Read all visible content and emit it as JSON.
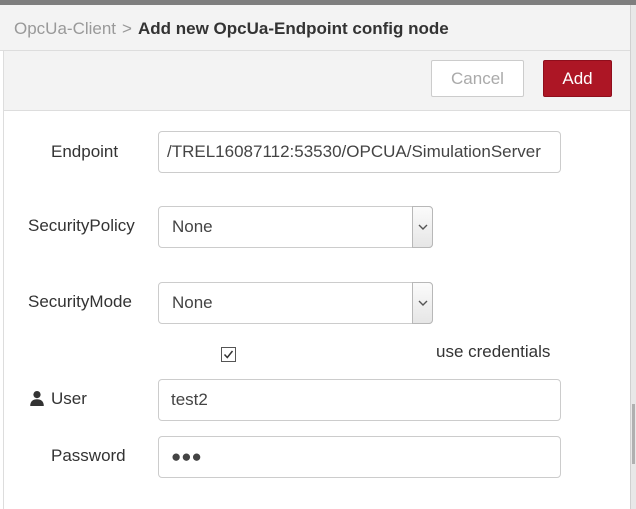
{
  "header": {
    "parent": "OpcUa-Client",
    "separator": ">",
    "title": "Add new OpcUa-Endpoint config node"
  },
  "toolbar": {
    "cancel_label": "Cancel",
    "add_label": "Add",
    "add_color": "#ad1625"
  },
  "form": {
    "endpoint": {
      "label": "Endpoint",
      "value": "/TREL16087112:53530/OPCUA/SimulationServer"
    },
    "security_policy": {
      "label": "SecurityPolicy",
      "value": "None"
    },
    "security_mode": {
      "label": "SecurityMode",
      "value": "None"
    },
    "use_credentials": {
      "label": "use credentials",
      "checked": true
    },
    "user": {
      "label": "User",
      "icon": "user-icon",
      "value": "test2"
    },
    "password": {
      "label": "Password",
      "masked_value": "●●●"
    }
  }
}
